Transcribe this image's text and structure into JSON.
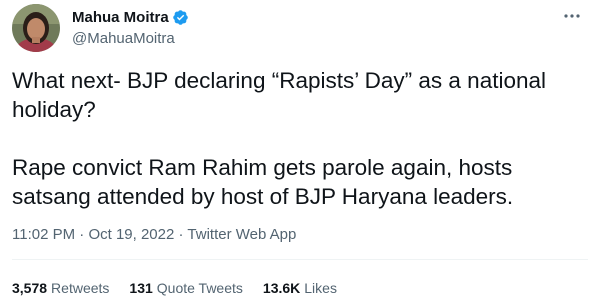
{
  "author": {
    "display_name": "Mahua Moitra",
    "handle": "@MahuaMoitra",
    "verified": true
  },
  "tweet": {
    "paragraph1": "What next- BJP declaring “Rapists’ Day” as a national holiday?",
    "paragraph2": "Rape convict Ram Rahim gets parole again, hosts satsang attended by host of BJP Haryana leaders."
  },
  "meta": {
    "time": "11:02 PM",
    "sep1": " · ",
    "date": "Oct 19, 2022",
    "sep2": " · ",
    "source": "Twitter Web App"
  },
  "stats": {
    "retweets_count": "3,578",
    "retweets_label": "Retweets",
    "quotes_count": "131",
    "quotes_label": "Quote Tweets",
    "likes_count": "13.6K",
    "likes_label": "Likes"
  },
  "icons": {
    "verified": "verified-badge-icon",
    "more": "more-dots-icon"
  },
  "colors": {
    "verified_blue": "#1d9bf0",
    "secondary_text": "#536471",
    "primary_text": "#0f1419"
  }
}
